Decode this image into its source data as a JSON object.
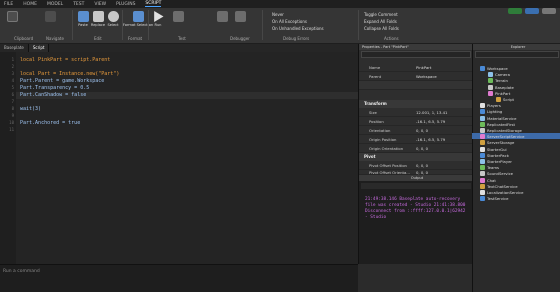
{
  "menubar": {
    "file": "FILE",
    "tabs": [
      "HOME",
      "MODEL",
      "TEST",
      "VIEW",
      "PLUGINS",
      "SCRIPT"
    ],
    "active_tab": "SCRIPT"
  },
  "ribbon": {
    "buttons": [
      "Paste",
      "Replace",
      "Select",
      "Format Selection",
      "Run"
    ],
    "groups": [
      "Clipboard",
      "Navigate",
      "Edit",
      "Format",
      "Test",
      "Debugger",
      "Debug Errors",
      "Actions"
    ],
    "debug_items": [
      "Never",
      "On All Exceptions",
      "On Unhandled Exceptions"
    ],
    "actions": [
      "Toggle Comment",
      "Expand All Folds",
      "Collapse All Folds"
    ]
  },
  "tabs": [
    "Baseplate",
    "Script"
  ],
  "code": {
    "line_numbers": [
      "1",
      "2",
      "3",
      "4",
      "5",
      "6",
      "7",
      "8",
      "9",
      "10",
      "11"
    ],
    "l1": "local PinkPart = script.Parent",
    "l3": "local Part = Instance.new(\"Part\")",
    "l4": "Part.Parent = game.Workspace",
    "l5": "Part.Transparency = 0.5",
    "l6": "Part.CanShadow = false",
    "l8": "wait(3)",
    "l10": "Part.Anchored = true"
  },
  "command_placeholder": "Run a command",
  "properties": {
    "title": "Properties - Part \"PinkPart\"",
    "rows_top": [
      {
        "k": "Name",
        "v": "PinkPart"
      },
      {
        "k": "Parent",
        "v": "Workspace"
      }
    ],
    "section_transform": "Transform",
    "rows_transform": [
      {
        "k": "Size",
        "v": "12.001, 1, 13.41"
      },
      {
        "k": "Position",
        "v": "-16.1, 6.5, 5.79"
      },
      {
        "k": "Orientation",
        "v": "0, 0, 0"
      },
      {
        "k": "Origin Position",
        "v": "-16.1, 6.5, 5.79"
      },
      {
        "k": "Origin Orientation",
        "v": "0, 0, 0"
      }
    ],
    "section_pivot": "Pivot",
    "rows_pivot": [
      {
        "k": "Pivot Offset Position",
        "v": "0, 0, 0"
      },
      {
        "k": "Pivot Offset Orienta...",
        "v": "0, 0, 0"
      }
    ]
  },
  "output": {
    "title": "Output",
    "text": "21:49:38.146 Baseplate auto-recovery file was created - Studio 21:41:38.800 Disconnect from ::ffff:127.0.0.1|62942 - Studio"
  },
  "explorer": {
    "title": "Explorer",
    "tree": [
      {
        "label": "Workspace",
        "depth": 0
      },
      {
        "label": "Camera",
        "depth": 1
      },
      {
        "label": "Terrain",
        "depth": 1
      },
      {
        "label": "Baseplate",
        "depth": 1
      },
      {
        "label": "PinkPart",
        "depth": 1,
        "selected": true
      },
      {
        "label": "Script",
        "depth": 2
      },
      {
        "label": "Players",
        "depth": 0
      },
      {
        "label": "Lighting",
        "depth": 0
      },
      {
        "label": "MaterialService",
        "depth": 0
      },
      {
        "label": "ReplicatedFirst",
        "depth": 0
      },
      {
        "label": "ReplicatedStorage",
        "depth": 0
      },
      {
        "label": "ServerScriptService",
        "depth": 0
      },
      {
        "label": "ServerStorage",
        "depth": 0
      },
      {
        "label": "StarterGui",
        "depth": 0
      },
      {
        "label": "StarterPack",
        "depth": 0
      },
      {
        "label": "StarterPlayer",
        "depth": 0
      },
      {
        "label": "Teams",
        "depth": 0
      },
      {
        "label": "SoundService",
        "depth": 0
      },
      {
        "label": "Chat",
        "depth": 0
      },
      {
        "label": "TextChatService",
        "depth": 0
      },
      {
        "label": "LocalizationService",
        "depth": 0
      },
      {
        "label": "TestService",
        "depth": 0
      }
    ]
  },
  "colors": {
    "accent": "#3d6aa8",
    "output_text": "#c86be0",
    "keyword": "#e89b3c"
  }
}
